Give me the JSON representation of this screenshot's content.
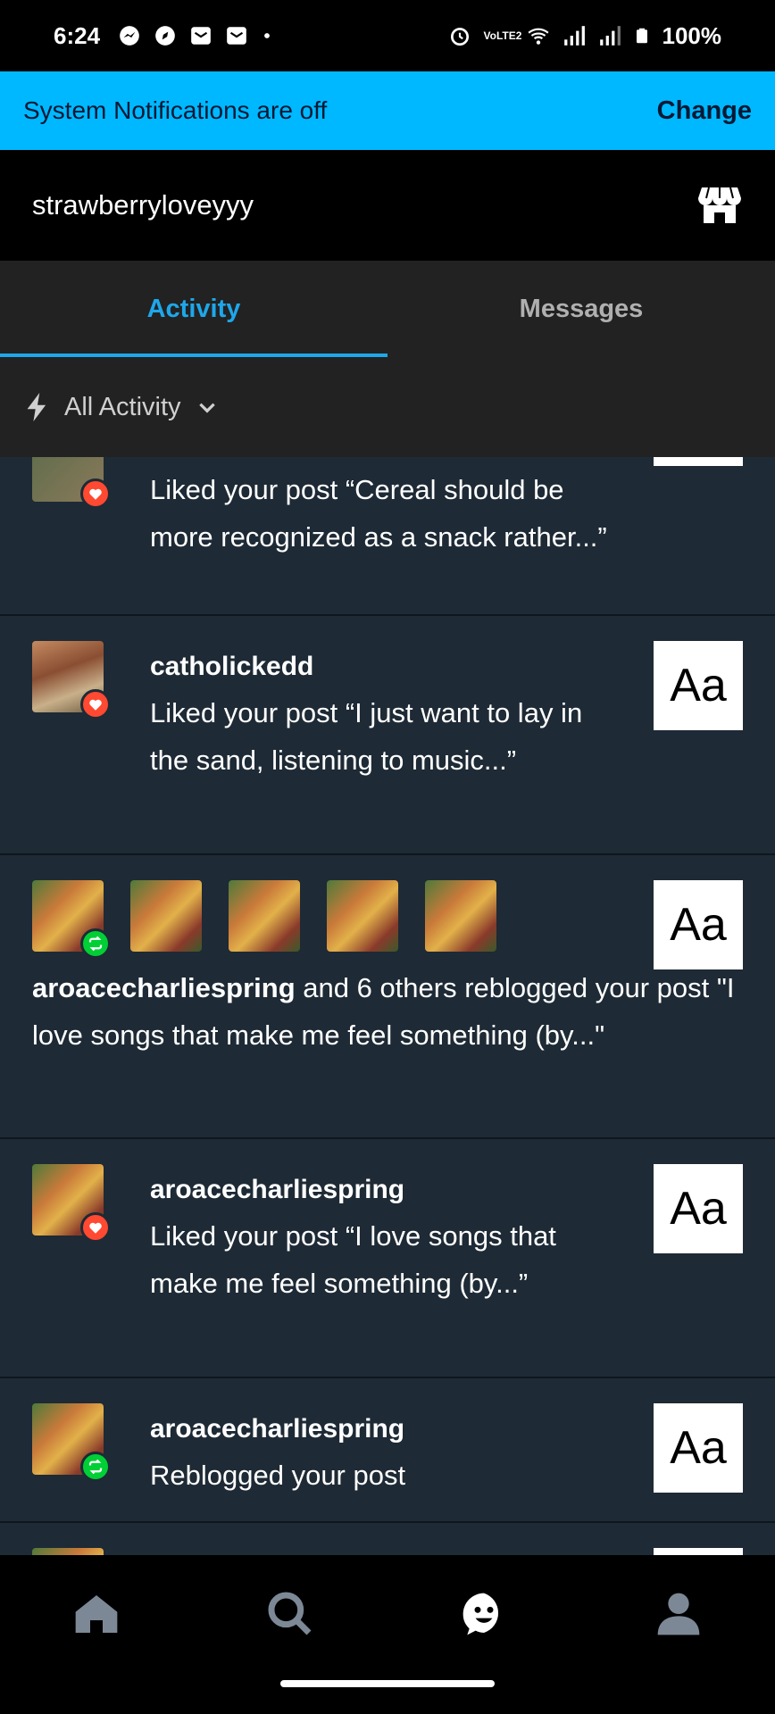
{
  "status_bar": {
    "time": "6:24",
    "left_icons": [
      "messenger-icon",
      "nav-compass-icon",
      "mail-icon",
      "mail-icon",
      "dot-icon"
    ],
    "right_icons": [
      "alarm-icon",
      "volte-icon",
      "wifi-icon",
      "signal-icon",
      "signal-icon",
      "battery-icon"
    ],
    "volte_label": "VoLTE2",
    "battery": "100%"
  },
  "notification_banner": {
    "text": "System Notifications are off",
    "action": "Change"
  },
  "header": {
    "blog_name": "strawberryloveyyy",
    "shop_icon": "store-icon"
  },
  "tabs": [
    {
      "label": "Activity",
      "active": true
    },
    {
      "label": "Messages",
      "active": false
    }
  ],
  "filter": {
    "icon": "lightning-icon",
    "label": "All Activity",
    "chevron": "chevron-down-icon"
  },
  "feed": {
    "items": [
      {
        "type": "like",
        "username": "",
        "text": "Liked your post “Cereal should be more recognized as a snack rather...”",
        "thumb": "Aa"
      },
      {
        "type": "like",
        "username": "catholickedd",
        "text": "Liked your post “I just want to lay in the sand, listening to music...”",
        "thumb": "Aa"
      },
      {
        "type": "group_reblog",
        "username": "aroacecharliespring",
        "text": " and 6 others reblogged your post \"I love songs that make me feel something (by...\"",
        "thumb": "Aa"
      },
      {
        "type": "like",
        "username": "aroacecharliespring",
        "text": "Liked your post “I love songs that make me feel something (by...”",
        "thumb": "Aa"
      },
      {
        "type": "reblog",
        "username": "aroacecharliespring",
        "text": "Reblogged your post",
        "thumb": "Aa"
      }
    ]
  },
  "bottom_nav": [
    {
      "name": "home-icon"
    },
    {
      "name": "search-icon"
    },
    {
      "name": "activity-face-icon"
    },
    {
      "name": "account-icon"
    }
  ],
  "colors": {
    "accent": "#1ea7ea",
    "banner": "#00b8ff",
    "like": "#ff4930",
    "reblog": "#00cf35",
    "feed_bg": "#1e2a35"
  }
}
